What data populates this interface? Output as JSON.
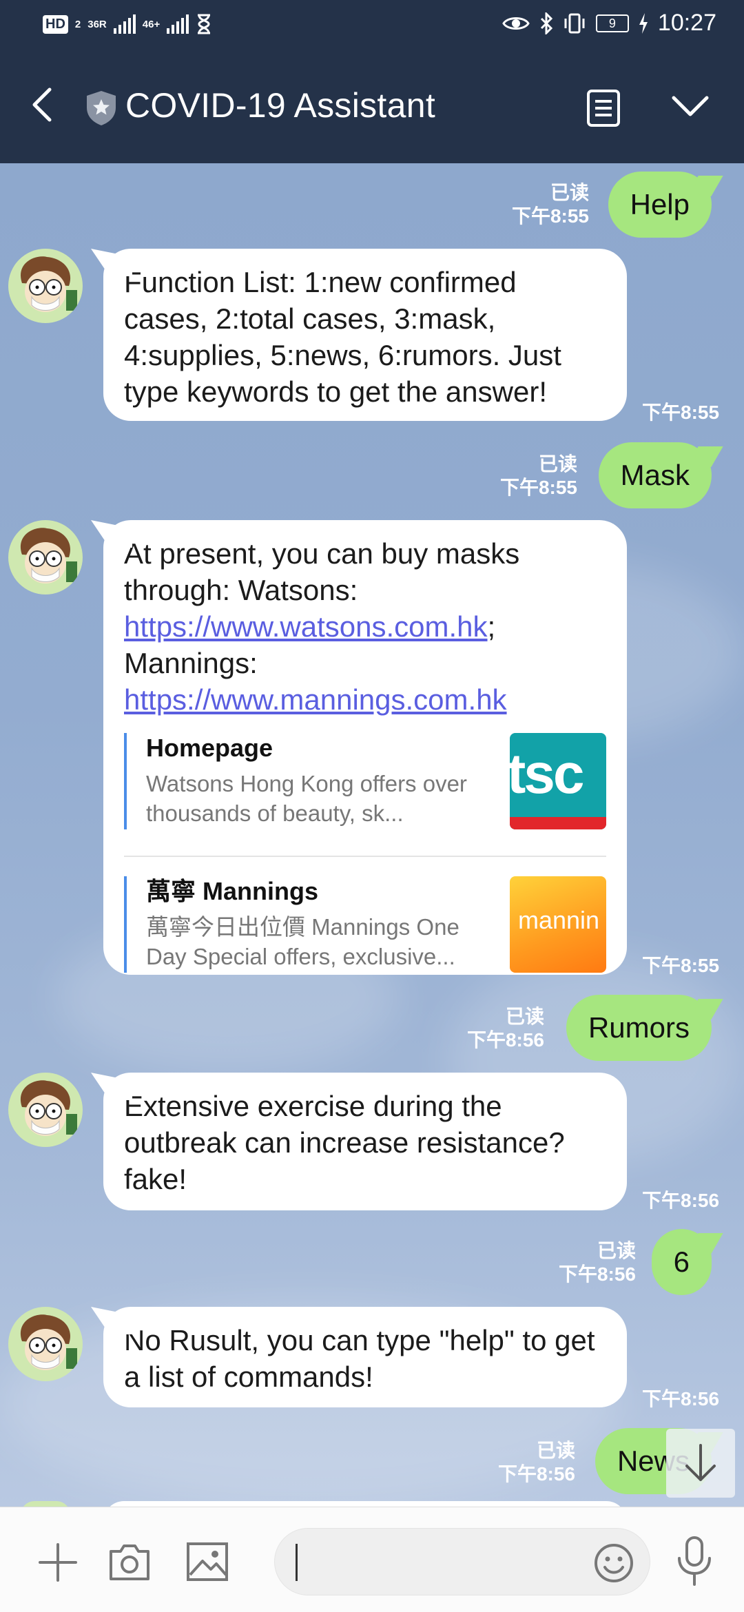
{
  "status_bar": {
    "hd": "HD",
    "sim": "2",
    "net1": "36R",
    "net2": "46+",
    "battery": "9",
    "time": "10:27"
  },
  "header": {
    "title": "COVID-19 Assistant"
  },
  "messages": [
    {
      "id": "m1",
      "text": "Help",
      "read": "已读",
      "time": "下午8:55"
    },
    {
      "id": "m2",
      "text": "Function List: 1:new confirmed cases, 2:total cases, 3:mask, 4:supplies, 5:news, 6:rumors. Just type keywords to get the answer!",
      "time": "下午8:55"
    },
    {
      "id": "m3",
      "text": "Mask",
      "read": "已读",
      "time": "下午8:55"
    },
    {
      "id": "m4",
      "text_a": "At present, you can buy masks through: Watsons: ",
      "link1": "https://www.watsons.com.hk",
      "text_b": "; Mannings: ",
      "link2": "https://www.mannings.com.hk",
      "previews": [
        {
          "title": "Homepage",
          "desc": "Watsons Hong Kong offers over thousands of beauty, sk...",
          "thumb_text": "tsc"
        },
        {
          "title": "萬寧 Mannings",
          "desc": "萬寧今日出位價 Mannings One Day Special offers, exclusive...",
          "thumb_text": "mannin"
        }
      ],
      "time": "下午8:55"
    },
    {
      "id": "m5",
      "text": "Rumors",
      "read": "已读",
      "time": "下午8:56"
    },
    {
      "id": "m6",
      "text": "Extensive exercise during the outbreak can increase resistance? fake!",
      "time": "下午8:56"
    },
    {
      "id": "m7",
      "text": "6",
      "read": "已读",
      "time": "下午8:56"
    },
    {
      "id": "m8",
      "text": "No Rusult, you can type \"help\" to get a list of commands!",
      "time": "下午8:56"
    },
    {
      "id": "m9",
      "text": "News",
      "read": "已读",
      "time": "下午8:56"
    }
  ],
  "colors": {
    "header": "#243249",
    "outgoing": "#a6e67f",
    "incoming": "#ffffff",
    "link": "#5a5ee0"
  }
}
